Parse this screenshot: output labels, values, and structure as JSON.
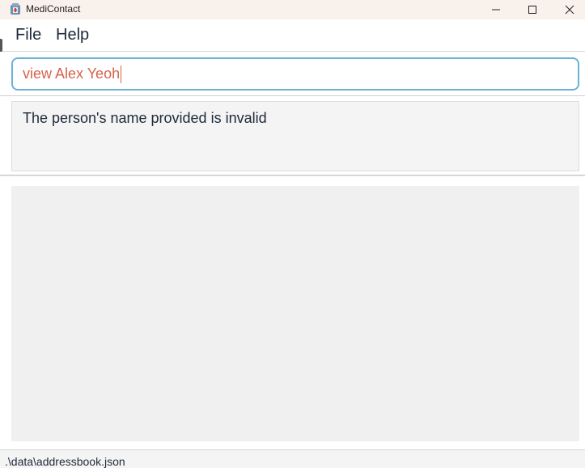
{
  "window": {
    "title": "MediContact",
    "icons": {
      "app": "app-icon",
      "minimize": "minimize-icon",
      "maximize": "maximize-icon",
      "close": "close-icon"
    }
  },
  "menu": {
    "items": [
      {
        "label": "File"
      },
      {
        "label": "Help"
      }
    ]
  },
  "command_box": {
    "value": "view Alex Yeoh",
    "text_color": "#d5634a",
    "border_color": "#6ab2d8"
  },
  "result_display": {
    "message": "The person's name provided is invalid"
  },
  "status_bar": {
    "file_path": ".\\data\\addressbook.json"
  }
}
